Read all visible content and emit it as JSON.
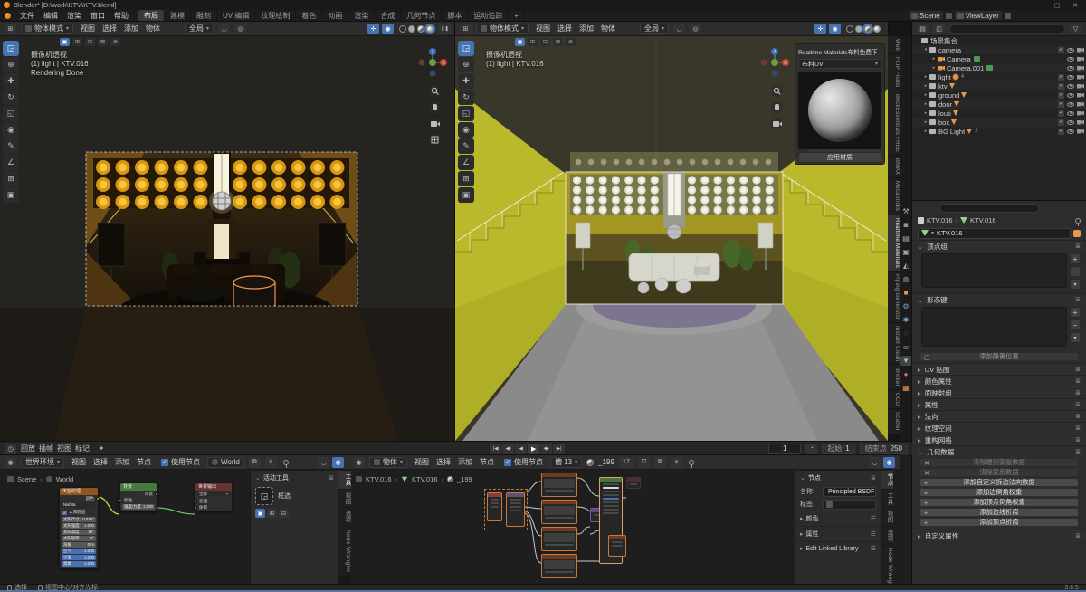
{
  "window": {
    "title": "Blender* [D:\\work\\KTV\\KTV.blend]"
  },
  "icons": {
    "dropdown": "▾",
    "caret_open": "▾",
    "caret_closed": "▸",
    "chev": "›",
    "panel_open": "⌄",
    "panel_closed": "▸",
    "menu_dots": "≣",
    "list": "☰",
    "plus": "+",
    "minus": "−",
    "x": "✕",
    "check": "✓",
    "minimize": "—",
    "maximize": "▢",
    "close": "✕",
    "pause": "❚❚",
    "record": "●"
  },
  "topbar": {
    "menus": [
      "文件",
      "编辑",
      "渲染",
      "窗口",
      "帮助"
    ],
    "workspaces": [
      "布局",
      "建模",
      "雕刻",
      "UV 编辑",
      "纹理绘制",
      "着色",
      "动画",
      "渲染",
      "合成",
      "几何节点",
      "脚本",
      "运动追踪"
    ],
    "active_workspace": "布局",
    "add_workspace": "+",
    "scene": {
      "label": "Scene"
    },
    "view_layer": {
      "label": "ViewLayer"
    }
  },
  "viewport": {
    "mode": "物体模式",
    "menus": [
      "视图",
      "选择",
      "添加",
      "物体"
    ],
    "orientation": "全局",
    "tools": [
      "select-box",
      "cursor",
      "move",
      "rotate",
      "scale",
      "transform",
      "annotate",
      "measure",
      "add-cube",
      "camera-view"
    ],
    "select_modes": [
      "new",
      "extend",
      "subtract",
      "invert",
      "intersect"
    ],
    "left_overlay": {
      "view": "摄像机透视",
      "stats": "(1) light | KTV.016",
      "status": "Rendering Done"
    },
    "right_overlay": {
      "view": "摄像机透视",
      "stats": "(1) light | KTV.016"
    }
  },
  "rm_panel": {
    "title": "Realtime Materials布料免费下",
    "preset": "布料UV",
    "apply_button": "应用材质"
  },
  "sidebar_tabs": {
    "items": [
      "Web",
      "FLIP Fluids",
      "BrickEssentials FREE",
      "BMAX",
      "Mecabricks",
      "Realtime Materials",
      "Piping Generator",
      "Instant Clean",
      "Bricker",
      "OCD",
      "Scatter"
    ],
    "active": "Realtime Materials"
  },
  "outliner": {
    "rows": [
      {
        "label": "场景集合",
        "icon": "collection",
        "level": 0,
        "caret": "",
        "right": []
      },
      {
        "label": "camera",
        "icon": "collection",
        "level": 1,
        "caret": "open",
        "right": [
          "check",
          "eye",
          "cam"
        ]
      },
      {
        "label": "Camera",
        "icon": "camera",
        "level": 2,
        "caret": "closed",
        "badge": true,
        "right": [
          "eye",
          "cam"
        ]
      },
      {
        "label": "Camera.001",
        "icon": "camera",
        "level": 2,
        "caret": "closed",
        "badge": true,
        "right": [
          "eye",
          "cam"
        ]
      },
      {
        "label": "light",
        "icon": "collection",
        "level": 1,
        "caret": "closed",
        "citype": "light",
        "count": "4",
        "right": [
          "check",
          "eye",
          "cam"
        ]
      },
      {
        "label": "ktv",
        "icon": "collection",
        "level": 1,
        "caret": "closed",
        "citype": "mesh",
        "count": "",
        "right": [
          "check",
          "eye",
          "cam"
        ]
      },
      {
        "label": "ground",
        "icon": "collection",
        "level": 1,
        "caret": "closed",
        "citype": "mesh",
        "count": "",
        "right": [
          "check",
          "eye",
          "cam"
        ]
      },
      {
        "label": "door",
        "icon": "collection",
        "level": 1,
        "caret": "closed",
        "citype": "mesh",
        "count": "",
        "right": [
          "check",
          "eye",
          "cam"
        ]
      },
      {
        "label": "louti",
        "icon": "collection",
        "level": 1,
        "caret": "closed",
        "citype": "mesh",
        "count": "",
        "right": [
          "check",
          "eye",
          "cam"
        ]
      },
      {
        "label": "box",
        "icon": "collection",
        "level": 1,
        "caret": "closed",
        "citype": "mesh",
        "count": "",
        "right": [
          "check",
          "eye",
          "cam"
        ]
      },
      {
        "label": "BG Light",
        "icon": "collection",
        "level": 1,
        "caret": "closed",
        "citype": "mesh",
        "count": "2",
        "right": [
          "check",
          "eye",
          "cam"
        ]
      }
    ]
  },
  "prop_tabs": [
    {
      "name": "tool",
      "glyph": "⚒",
      "color": "#a8a8a8"
    },
    {
      "name": "render",
      "glyph": "◙",
      "color": "#a8a8a8"
    },
    {
      "name": "output",
      "glyph": "▤",
      "color": "#a8a8a8"
    },
    {
      "name": "view-layer",
      "glyph": "▣",
      "color": "#a8a8a8"
    },
    {
      "name": "scene",
      "glyph": "◭",
      "color": "#a8a8a8"
    },
    {
      "name": "world",
      "glyph": "◍",
      "color": "#a8a8a8"
    },
    {
      "name": "object",
      "glyph": "■",
      "color": "#e8974f"
    },
    {
      "name": "modifiers",
      "glyph": "⚙",
      "color": "#7aa7e0"
    },
    {
      "name": "particles",
      "glyph": "✱",
      "color": "#7aa7e0"
    },
    {
      "name": "physics",
      "glyph": "◌",
      "color": "#7aa7e0"
    },
    {
      "name": "constraints",
      "glyph": "∞",
      "color": "#a8a8a8"
    },
    {
      "name": "object-data",
      "glyph": "▼",
      "color": "#8fd18f",
      "active": true
    },
    {
      "name": "material",
      "glyph": "●",
      "color": "#d87070"
    },
    {
      "name": "texture",
      "glyph": "▦",
      "color": "#e8974f"
    }
  ],
  "properties": {
    "breadcrumb": [
      "KTV.016",
      "KTV.016"
    ],
    "datablock": "KTV.016",
    "panels": {
      "vertex_groups": "顶点组",
      "shape_keys": "形态键",
      "rest_position": "添加静置位置",
      "collapsed": [
        "UV 贴图",
        "颜色属性",
        "面映射组",
        "属性",
        "法向",
        "纹理空间",
        "重构网格"
      ],
      "geometry": "几何数据",
      "geometry_buttons": [
        {
          "icon": "x",
          "label": "清除雕刻蒙版数据",
          "disabled": true
        },
        {
          "icon": "x",
          "label": "清除蒙皮数据",
          "disabled": true
        },
        {
          "icon": "plus",
          "label": "添加自定义拆边法向数据",
          "disabled": false
        },
        {
          "icon": "plus",
          "label": "添加边倒角权重",
          "disabled": false
        },
        {
          "icon": "plus",
          "label": "添加顶点倒角权重",
          "disabled": false
        },
        {
          "icon": "plus",
          "label": "添加边线折痕",
          "disabled": false
        },
        {
          "icon": "plus",
          "label": "添加顶点折痕",
          "disabled": false
        }
      ],
      "custom": "自定义属性"
    }
  },
  "timeline": {
    "menus": [
      "回放",
      "插帧",
      "视图",
      "标记"
    ],
    "playback": [
      "jump-to-start",
      "previous-keyframe",
      "reverse-play",
      "play",
      "next-keyframe",
      "jump-to-end"
    ],
    "frame": "1",
    "start_label": "起始",
    "start": "1",
    "end_label": "结束点",
    "end": "250"
  },
  "world_editor": {
    "type": "世界环境",
    "menus": [
      "视图",
      "选择",
      "添加",
      "节点"
    ],
    "use_nodes": "使用节点",
    "datablock": "World",
    "breadcrumb": [
      "Scene",
      "World"
    ],
    "nodes": {
      "sky": {
        "title": "天空纹理",
        "output": "颜色",
        "type": "Nishita",
        "sun_disc": "太阳圆盘",
        "fields": [
          {
            "label": "太阳尺寸",
            "value": "0.545°",
            "style": "plain"
          },
          {
            "label": "太阳强度",
            "value": "1.000",
            "style": "plain"
          },
          {
            "label": "太阳高度",
            "value": "15°",
            "style": "plain"
          },
          {
            "label": "太阳旋转",
            "value": "0°",
            "style": "plain"
          },
          {
            "label": "海拔",
            "value": "0 m",
            "style": "plain"
          },
          {
            "label": "空气",
            "value": "1.000",
            "style": "slider"
          },
          {
            "label": "尘埃",
            "value": "1.000",
            "style": "slider"
          },
          {
            "label": "臭氧",
            "value": "1.000",
            "style": "slider"
          }
        ]
      },
      "background": {
        "title": "背景",
        "output": "背景",
        "color_input": "颜色",
        "strength_label": "强度/力度",
        "strength": "1.000"
      },
      "output": {
        "title": "世界输出",
        "target": "全部",
        "surface": "表面",
        "volume": "体积"
      }
    },
    "n_panel": {
      "title": "活动工具",
      "tool": "框选"
    },
    "tabs": [
      "工具",
      "视图",
      "选项",
      "Node Wrangler"
    ],
    "active_tab": "工具"
  },
  "shader_editor": {
    "type": "物体",
    "menus": [
      "视图",
      "选择",
      "添加",
      "节点"
    ],
    "use_nodes": "使用节点",
    "slot": "槽 13",
    "material": "_199",
    "users": "17",
    "breadcrumb": [
      "KTV.016",
      "KTV.016",
      "_199"
    ],
    "n_panel": {
      "title": "节点",
      "name_label": "名称:",
      "name": "Principled BSDF",
      "label_label": "标签:",
      "sections": [
        "颜色",
        "属性",
        "Edit Linked Library"
      ]
    },
    "tabs": [
      "节点",
      "工具",
      "视图",
      "选项",
      "Node Wrangler"
    ],
    "active_tab": "节点"
  },
  "status_bar": {
    "items": [
      "选择",
      "视图中心/对齐光标"
    ],
    "version": "3.6.5"
  }
}
